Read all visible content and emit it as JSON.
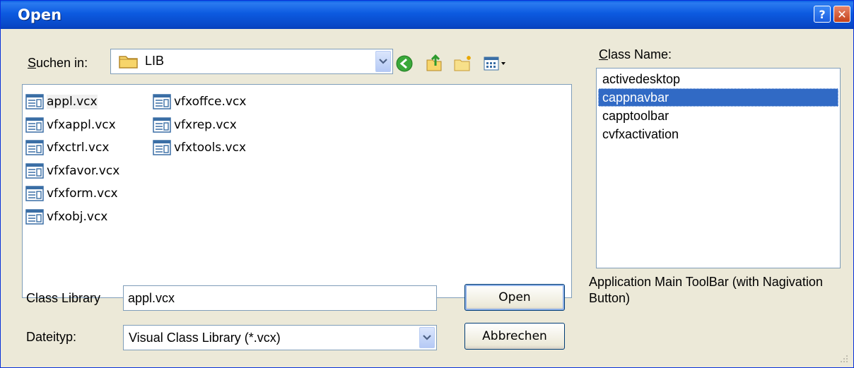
{
  "window": {
    "title": "Open",
    "help_glyph": "?",
    "close_glyph": "✕"
  },
  "lookin": {
    "label_prefix": "",
    "label_accel": "S",
    "label_rest": "uchen in:",
    "value": "LIB",
    "icons": [
      "folder-icon",
      "back-arrow-icon",
      "up-folder-icon",
      "new-folder-icon",
      "view-menu-icon"
    ]
  },
  "files": [
    {
      "name": "appl.vcx",
      "selected": true
    },
    {
      "name": "vfxappl.vcx"
    },
    {
      "name": "vfxctrl.vcx"
    },
    {
      "name": "vfxfavor.vcx"
    },
    {
      "name": "vfxform.vcx"
    },
    {
      "name": "vfxobj.vcx"
    },
    {
      "name": "vfxoffce.vcx"
    },
    {
      "name": "vfxrep.vcx"
    },
    {
      "name": "vfxtools.vcx"
    }
  ],
  "classlib": {
    "label": "Class Library",
    "value": "appl.vcx"
  },
  "filetype": {
    "label": "Dateityp:",
    "value": "Visual Class Library (*.vcx)"
  },
  "buttons": {
    "open": "Open",
    "cancel": "Abbrechen"
  },
  "classname": {
    "label_accel": "C",
    "label_rest": "lass Name:",
    "items": [
      "activedesktop",
      "cappnavbar",
      "capptoolbar",
      "cvfxactivation"
    ],
    "selected_index": 1
  },
  "description": "Application Main ToolBar (with Nagivation Button)",
  "colors": {
    "titlebar": "#0a5fe4",
    "selection": "#316ac5",
    "dialog_bg": "#ece9d8"
  }
}
